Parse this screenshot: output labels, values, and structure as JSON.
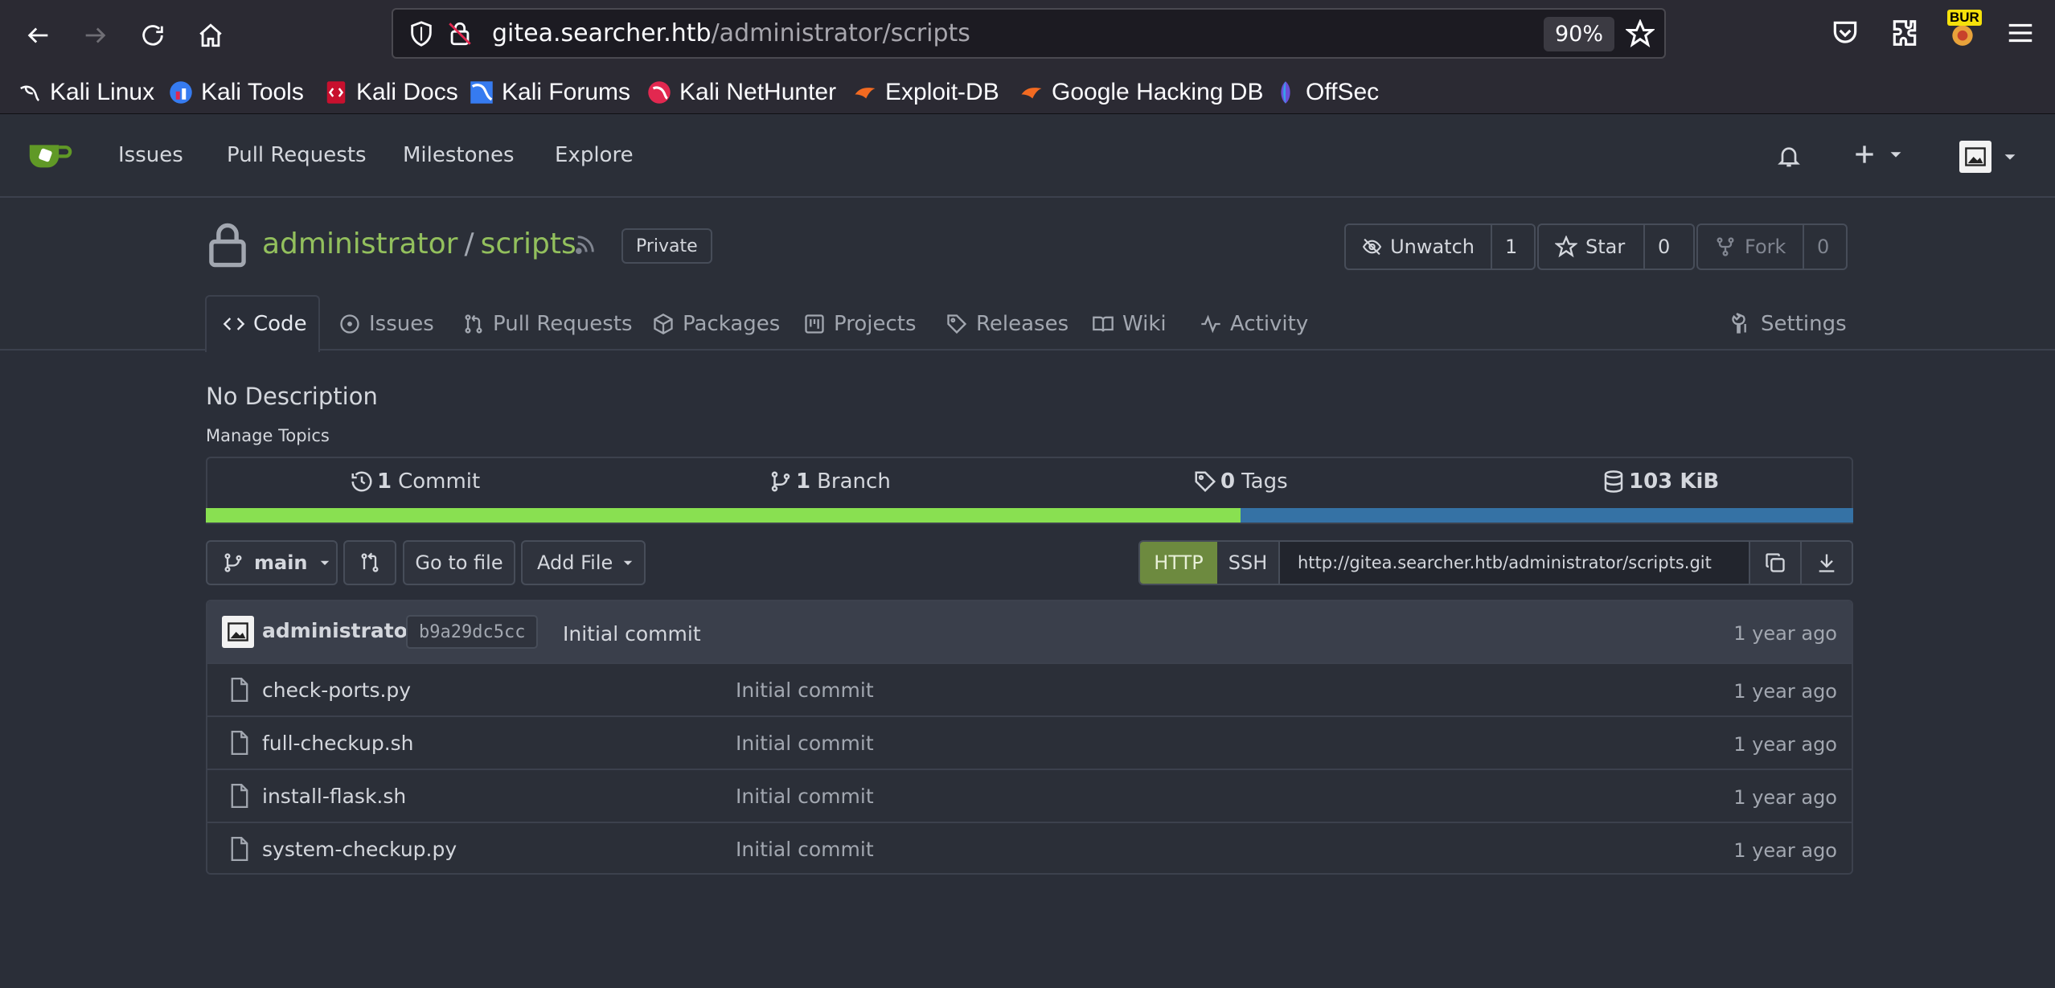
{
  "browser": {
    "url_host": "gitea.searcher.htb",
    "url_path": "/administrator/scripts",
    "zoom": "90%",
    "burp_badge": "BUR",
    "bookmarks": [
      {
        "label": "Kali Linux",
        "icon": "kali-dragon-icon"
      },
      {
        "label": "Kali Tools",
        "icon": "kali-tools-icon"
      },
      {
        "label": "Kali Docs",
        "icon": "kali-docs-icon"
      },
      {
        "label": "Kali Forums",
        "icon": "kali-forums-icon"
      },
      {
        "label": "Kali NetHunter",
        "icon": "nethunter-icon"
      },
      {
        "label": "Exploit-DB",
        "icon": "exploit-db-icon"
      },
      {
        "label": "Google Hacking DB",
        "icon": "ghdb-icon"
      },
      {
        "label": "OffSec",
        "icon": "offsec-icon"
      }
    ]
  },
  "nav": {
    "items": [
      "Issues",
      "Pull Requests",
      "Milestones",
      "Explore"
    ]
  },
  "repo": {
    "owner": "administrator",
    "name": "scripts",
    "visibility": "Private",
    "watch_label": "Unwatch",
    "watch_count": "1",
    "star_label": "Star",
    "star_count": "0",
    "fork_label": "Fork",
    "fork_count": "0",
    "tabs": [
      "Code",
      "Issues",
      "Pull Requests",
      "Packages",
      "Projects",
      "Releases",
      "Wiki",
      "Activity"
    ],
    "settings_tab": "Settings",
    "description": "No Description",
    "manage_topics": "Manage Topics"
  },
  "stats": {
    "commits_num": "1",
    "commits_label": "Commit",
    "branches_num": "1",
    "branches_label": "Branch",
    "tags_num": "0",
    "tags_label": "Tags",
    "size": "103 KiB"
  },
  "languages": [
    {
      "fraction": 0.628,
      "color": "#89e051"
    },
    {
      "fraction": 0.372,
      "color": "#3572a5"
    }
  ],
  "toolbar": {
    "branch": "main",
    "go_to_file": "Go to file",
    "add_file": "Add File",
    "http": "HTTP",
    "ssh": "SSH",
    "clone_url": "http://gitea.searcher.htb/administrator/scripts.git"
  },
  "latest_commit": {
    "author": "administrator",
    "sha": "b9a29dc5cc",
    "message": "Initial commit",
    "time": "1 year ago"
  },
  "files": [
    {
      "name": "check-ports.py",
      "message": "Initial commit",
      "time": "1 year ago"
    },
    {
      "name": "full-checkup.sh",
      "message": "Initial commit",
      "time": "1 year ago"
    },
    {
      "name": "install-flask.sh",
      "message": "Initial commit",
      "time": "1 year ago"
    },
    {
      "name": "system-checkup.py",
      "message": "Initial commit",
      "time": "1 year ago"
    }
  ],
  "colors": {
    "accent_green": "#93c05d",
    "http_active": "#6d8a3f",
    "background": "#2a2e38"
  }
}
